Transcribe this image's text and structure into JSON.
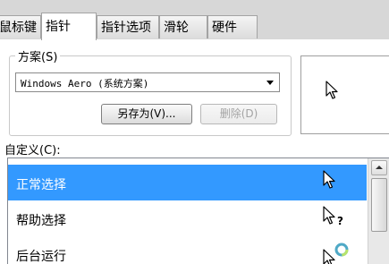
{
  "tabs": [
    {
      "label": "鼠标键"
    },
    {
      "label": "指针"
    },
    {
      "label": "指针选项"
    },
    {
      "label": "滑轮"
    },
    {
      "label": "硬件"
    }
  ],
  "scheme": {
    "group_label": "方案(S)",
    "selected": "Windows Aero (系统方案)",
    "save_as_label": "另存为(V)...",
    "delete_label": "删除(D)"
  },
  "custom_label": "自定义(C):",
  "cursor_list": [
    {
      "label": "正常选择",
      "icon": "arrow-cursor-icon",
      "selected": true
    },
    {
      "label": "帮助选择",
      "icon": "help-cursor-icon",
      "selected": false
    },
    {
      "label": "后台运行",
      "icon": "busy-cursor-icon",
      "selected": false
    }
  ],
  "colors": {
    "selection": "#3399ff",
    "window": "#ffffff",
    "tab_strip": "#d7d7d7"
  }
}
